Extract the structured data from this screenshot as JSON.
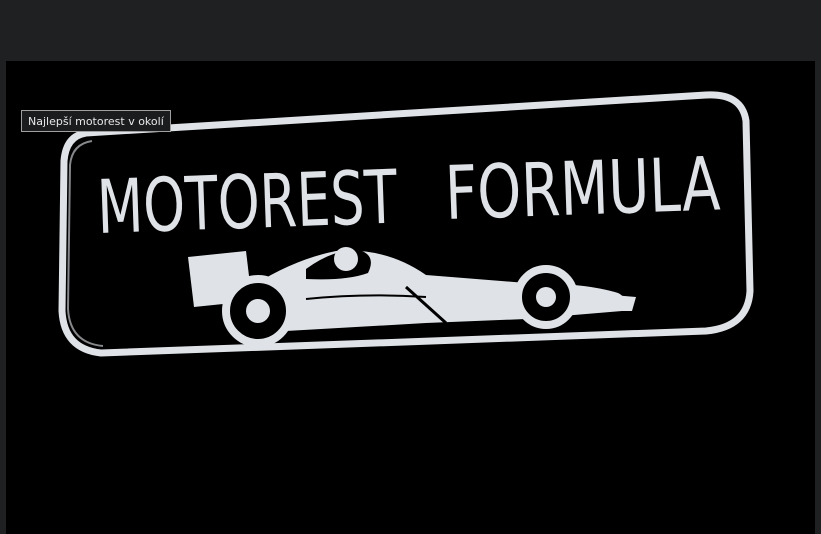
{
  "tooltip": {
    "text": "Najlepší motorest v okolí"
  },
  "logo": {
    "word1": "MOTOREST",
    "word2": "FORMULA",
    "colors": {
      "ink": "#dfe3e8",
      "background": "#000000"
    }
  },
  "colors": {
    "chrome": "#1f2022",
    "viewer": "#000000"
  }
}
